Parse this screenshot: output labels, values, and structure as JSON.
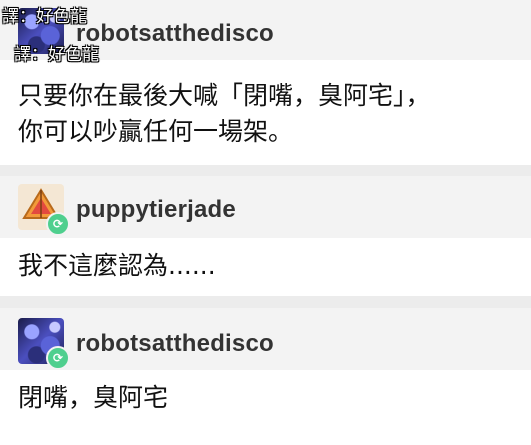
{
  "watermark": {
    "primary": "譯：好色龍",
    "secondary": "譯：好色龍"
  },
  "posts": [
    {
      "username": "robotsatthedisco",
      "avatar": "robot-collage-avatar",
      "has_reblog_badge": false,
      "lines": [
        "只要你在最後大喊「閉嘴，臭阿宅」，",
        "你可以吵贏任何一場架。"
      ]
    },
    {
      "username": "puppytierjade",
      "avatar": "orange-triangle-avatar",
      "has_reblog_badge": true,
      "lines": [
        "我不這麼認為......"
      ]
    },
    {
      "username": "robotsatthedisco",
      "avatar": "robot-collage-avatar",
      "has_reblog_badge": true,
      "lines": [
        "閉嘴，臭阿宅"
      ]
    }
  ],
  "colors": {
    "header_bg": "#f3f3f3",
    "reblog_badge": "#4fcf8e",
    "background": "#ececec"
  }
}
